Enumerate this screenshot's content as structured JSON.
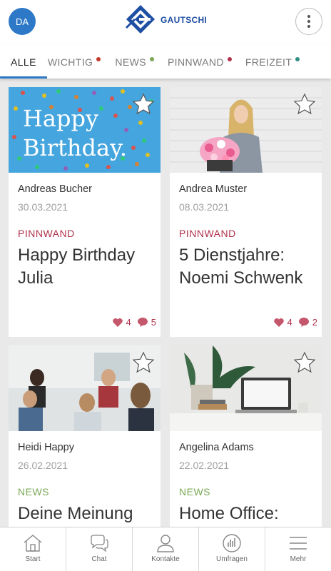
{
  "header": {
    "avatar_initials": "DA",
    "logo_text": "GAUTSCHI",
    "brand_color": "#1f4fa3"
  },
  "tabs": [
    {
      "label": "ALLE",
      "active": true
    },
    {
      "label": "WICHTIG",
      "dot_color": "#c0392b"
    },
    {
      "label": "NEWS",
      "dot_color": "#7aa856"
    },
    {
      "label": "PINNWAND",
      "dot_color": "#b0324a"
    },
    {
      "label": "FREIZEIT",
      "dot_color": "#2e8f86"
    }
  ],
  "cards": [
    {
      "image": "happy-birthday-confetti",
      "image_text": [
        "Happy",
        "Birthday."
      ],
      "author": "Andreas Bucher",
      "date": "30.03.2021",
      "category": "PINNWAND",
      "category_color": "#b0324a",
      "title": "Happy Birthday Julia",
      "likes": "4",
      "comments": "5"
    },
    {
      "image": "woman-with-flowers",
      "author": "Andrea Muster",
      "date": "08.03.2021",
      "category": "PINNWAND",
      "category_color": "#b0324a",
      "title": "5 Dienstjahre: Noemi Schwenk",
      "likes": "4",
      "comments": "2"
    },
    {
      "image": "team-meeting",
      "author": "Heidi Happy",
      "date": "26.02.2021",
      "category": "NEWS",
      "category_color": "#7aa856",
      "title": "Deine Meinung"
    },
    {
      "image": "laptop-desk",
      "author": "Angelina Adams",
      "date": "22.02.2021",
      "category": "NEWS",
      "category_color": "#7aa856",
      "title": "Home Office:"
    }
  ],
  "bottom_nav": [
    {
      "label": "Start",
      "icon": "home-icon"
    },
    {
      "label": "Chat",
      "icon": "chat-icon"
    },
    {
      "label": "Kontakte",
      "icon": "person-icon"
    },
    {
      "label": "Umfragen",
      "icon": "poll-icon"
    },
    {
      "label": "Mehr",
      "icon": "hamburger-icon"
    }
  ]
}
